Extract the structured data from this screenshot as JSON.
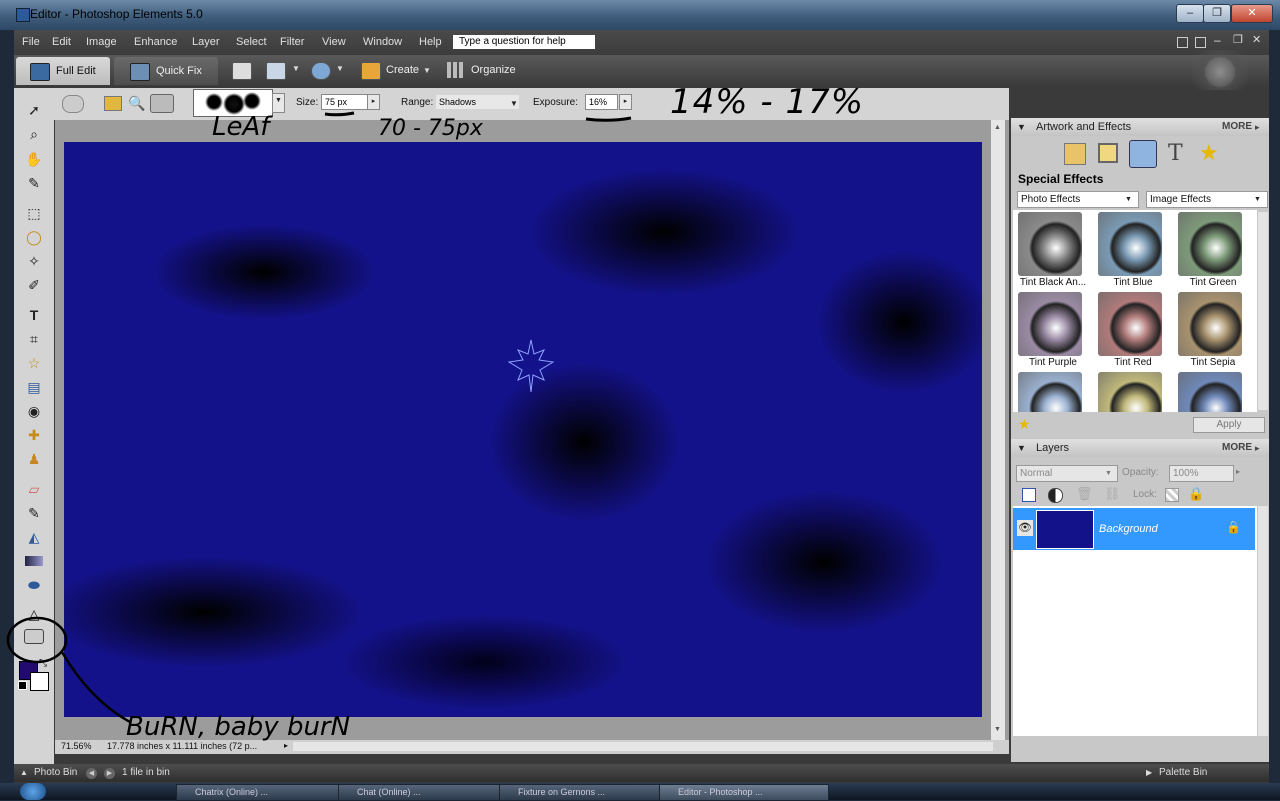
{
  "window": {
    "title": "Editor - Photoshop Elements 5.0",
    "min": "‒",
    "max": "❐",
    "close": "✕"
  },
  "menus": [
    "File",
    "Edit",
    "Image",
    "Enhance",
    "Layer",
    "Select",
    "Filter",
    "View",
    "Window",
    "Help"
  ],
  "search": {
    "placeholder": "Type a question for help"
  },
  "mode_tabs": {
    "full_edit": "Full Edit",
    "quick_fix": "Quick Fix",
    "create": "Create",
    "organize": "Organize"
  },
  "options": {
    "size_label": "Size:",
    "size_value": "75 px",
    "range_label": "Range:",
    "range_value": "Shadows",
    "exposure_label": "Exposure:",
    "exposure_value": "16%"
  },
  "annotations": {
    "exposure_note": "14% - 17%",
    "brush_note": "LeAf",
    "size_note": "70 - 75px",
    "tool_note": "BuRN, baby burN"
  },
  "canvas": {
    "bg_color": "#14128a"
  },
  "status": {
    "zoom": "71.56%",
    "doc_info": "17.778 inches x 11.111 inches (72 p..."
  },
  "artwork": {
    "title": "Artwork and Effects",
    "more": "MORE",
    "section": "Special Effects",
    "dropdown1": "Photo Effects",
    "dropdown2": "Image Effects",
    "items": [
      {
        "label": "Tint Black An...",
        "color": "#8a8a8a"
      },
      {
        "label": "Tint Blue",
        "color": "#7a9ab4"
      },
      {
        "label": "Tint Green",
        "color": "#7e9a7a"
      },
      {
        "label": "Tint Purple",
        "color": "#9a8aa4"
      },
      {
        "label": "Tint Red",
        "color": "#b07a7a"
      },
      {
        "label": "Tint Sepia",
        "color": "#a8926e"
      },
      {
        "label": "",
        "color": "#9ab0d0"
      },
      {
        "label": "",
        "color": "#c0b87a"
      },
      {
        "label": "",
        "color": "#6e88b8"
      }
    ],
    "apply": "Apply"
  },
  "layers": {
    "title": "Layers",
    "more": "MORE",
    "blend_mode": "Normal",
    "opacity_label": "Opacity:",
    "opacity_value": "100%",
    "lock_label": "Lock:",
    "items": [
      {
        "name": "Background"
      }
    ]
  },
  "bottom": {
    "photo_bin": "Photo Bin",
    "files": "1 file in bin",
    "palette_bin": "Palette Bin"
  },
  "taskbar": {
    "items": [
      "Chatrix (Online) ...",
      "Chat (Online) ...",
      "Fixture on Gernons ...",
      "Editor - Photoshop ..."
    ]
  }
}
